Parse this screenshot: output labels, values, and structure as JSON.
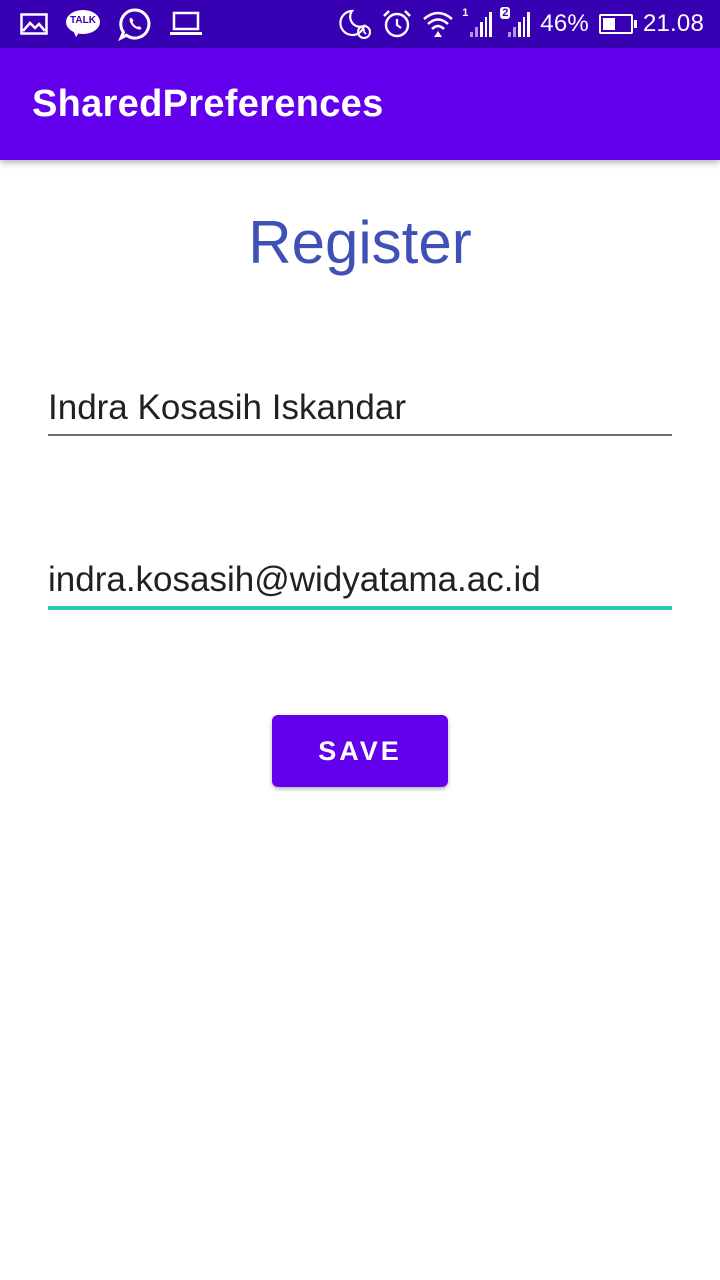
{
  "status_bar": {
    "left_icons": [
      "gallery-icon",
      "talk-icon",
      "whatsapp-icon",
      "laptop-icon"
    ],
    "talk_label": "TALK",
    "right_icons": [
      "moon-alarm-icon",
      "alarm-clock-icon",
      "wifi-icon",
      "signal-sim1-icon",
      "signal-sim2-icon",
      "battery-icon"
    ],
    "sim1_label": "1",
    "sim2_label": "2",
    "battery_percent": "46%",
    "battery_level": 0.46,
    "time": "21.08",
    "background_color": "#3700b3"
  },
  "app_bar": {
    "title": "SharedPreferences",
    "background_color": "#6200ee"
  },
  "form": {
    "heading": "Register",
    "heading_color": "#3f51b5",
    "name_field": {
      "value": "Indra Kosasih Iskandar"
    },
    "email_field": {
      "value": "indra.kosasih@widyatama.ac.id",
      "focused": true,
      "focus_color": "#26c6b9"
    },
    "save_button": {
      "label": "SAVE",
      "color": "#6200ee"
    }
  }
}
